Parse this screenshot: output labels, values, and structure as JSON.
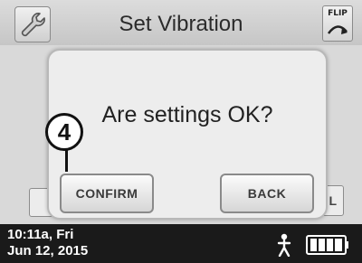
{
  "header": {
    "title": "Set Vibration",
    "flip_label": "FLIP",
    "tool_icon": "wrench-icon"
  },
  "dialog": {
    "message": "Are settings OK?",
    "confirm_label": "CONFIRM",
    "back_label": "BACK"
  },
  "background_buttons": {
    "right_partial_label": "EL"
  },
  "annotation": {
    "step_number": "4"
  },
  "status": {
    "time": "10:11a, Fri",
    "date": "Jun 12, 2015",
    "activity_icon": "person-icon",
    "battery_icon": "battery-full-icon",
    "battery_level": 1.0
  }
}
